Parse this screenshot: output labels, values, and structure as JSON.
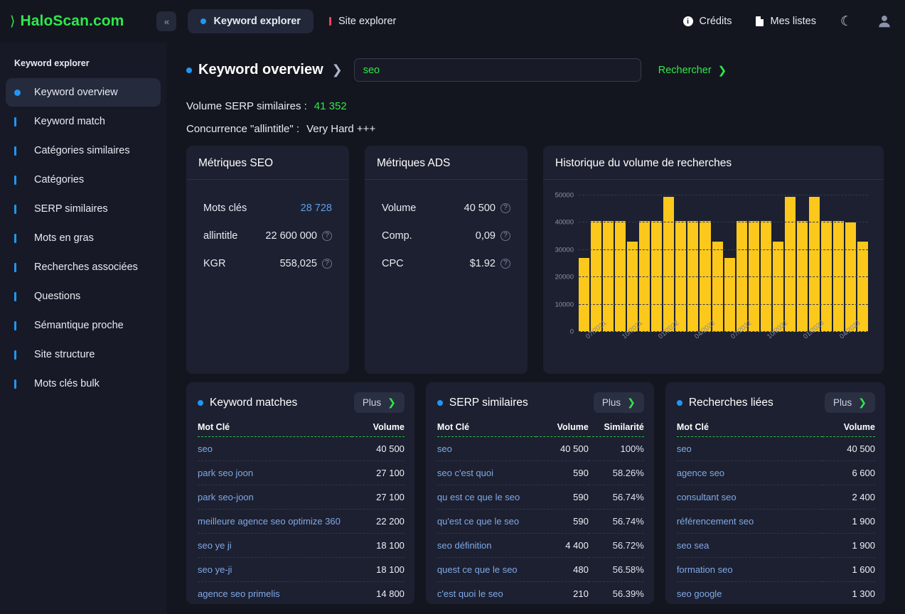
{
  "topbar": {
    "brand": "HaloScan.com",
    "brand_chevron": "⟩",
    "collapse_label": "«",
    "tabs": [
      {
        "label": "Keyword explorer",
        "marker": "dot-blue",
        "active": true
      },
      {
        "label": "Site explorer",
        "marker": "bar-pink",
        "active": false
      }
    ],
    "credits_label": "Crédits",
    "credits_icon": "info-icon",
    "lists_label": "Mes listes",
    "lists_icon": "document-icon",
    "theme_icon": "moon-icon",
    "theme_glyph": "☾",
    "account_icon": "user-avatar-icon"
  },
  "sidebar": {
    "title": "Keyword explorer",
    "items": [
      {
        "label": "Keyword overview",
        "active": true
      },
      {
        "label": "Keyword match",
        "active": false
      },
      {
        "label": "Catégories similaires",
        "active": false
      },
      {
        "label": "Catégories",
        "active": false
      },
      {
        "label": "SERP similaires",
        "active": false
      },
      {
        "label": "Mots en gras",
        "active": false
      },
      {
        "label": "Recherches associées",
        "active": false
      },
      {
        "label": "Questions",
        "active": false
      },
      {
        "label": "Sémantique proche",
        "active": false
      },
      {
        "label": "Site structure",
        "active": false
      },
      {
        "label": "Mots clés bulk",
        "active": false
      }
    ]
  },
  "page": {
    "title": "Keyword overview",
    "title_chevron": "❯",
    "search_value": "seo",
    "search_placeholder": "seo",
    "search_button": "Rechercher",
    "search_button_chevron": "❯",
    "summary": [
      {
        "label": "Volume SERP similaires :",
        "value": "41 352",
        "style": "green"
      },
      {
        "label": "Concurrence \"allintitle\" :",
        "value": "Very Hard +++",
        "style": "plain"
      }
    ]
  },
  "metrics_seo": {
    "title": "Métriques SEO",
    "rows": [
      {
        "label": "Mots clés",
        "value": "28 728",
        "help": false,
        "blue": true
      },
      {
        "label": "allintitle",
        "value": "22 600 000",
        "help": true,
        "blue": false
      },
      {
        "label": "KGR",
        "value": "558,025",
        "help": true,
        "blue": false
      }
    ]
  },
  "metrics_ads": {
    "title": "Métriques ADS",
    "rows": [
      {
        "label": "Volume",
        "value": "40 500",
        "help": true,
        "blue": false
      },
      {
        "label": "Comp.",
        "value": "0,09",
        "help": true,
        "blue": false
      },
      {
        "label": "CPC",
        "value": "$1.92",
        "help": true,
        "blue": false
      }
    ]
  },
  "chart_data": {
    "type": "bar",
    "title": "Historique du volume de recherches",
    "xlabel": "",
    "ylabel": "",
    "ylim": [
      0,
      52000
    ],
    "yticks": [
      0,
      10000,
      20000,
      30000,
      40000,
      50000
    ],
    "ytick_labels": [
      "0",
      "10000",
      "20000",
      "30000",
      "40000",
      "50000"
    ],
    "grid": true,
    "legend": "none",
    "bar_color": "#fcc81b",
    "categories": [
      "07/2021",
      "08/2021",
      "09/2021",
      "10/2021",
      "11/2021",
      "12/2021",
      "01/2022",
      "02/2022",
      "03/2022",
      "04/2022",
      "05/2022",
      "06/2022",
      "07/2022",
      "08/2022",
      "09/2022",
      "10/2022",
      "11/2022",
      "12/2022",
      "01/2023",
      "02/2023",
      "03/2023",
      "04/2023",
      "05/2023",
      "06/2023"
    ],
    "tick_labels_shown": [
      "07/2021",
      "10/2021",
      "01/2022",
      "04/2022",
      "07/2022",
      "10/2022",
      "01/2023",
      "04/2023"
    ],
    "tick_label_indices": [
      0,
      3,
      6,
      9,
      12,
      15,
      18,
      21
    ],
    "values": [
      27100,
      40500,
      40500,
      40500,
      33100,
      40500,
      40500,
      49500,
      40500,
      40500,
      40500,
      33100,
      27100,
      40500,
      40500,
      40500,
      33100,
      49500,
      40500,
      49500,
      40500,
      40500,
      40000,
      33100
    ]
  },
  "keyword_matches": {
    "title": "Keyword matches",
    "more_label": "Plus",
    "more_chevron": "❯",
    "columns": [
      "Mot Clé",
      "Volume"
    ],
    "rows": [
      {
        "keyword": "seo",
        "volume": "40 500"
      },
      {
        "keyword": "park seo joon",
        "volume": "27 100"
      },
      {
        "keyword": "park seo-joon",
        "volume": "27 100"
      },
      {
        "keyword": "meilleure agence seo optimize 360",
        "volume": "22 200"
      },
      {
        "keyword": "seo ye ji",
        "volume": "18 100"
      },
      {
        "keyword": "seo ye-ji",
        "volume": "18 100"
      },
      {
        "keyword": "agence seo primelis",
        "volume": "14 800"
      }
    ]
  },
  "serp_similaires": {
    "title": "SERP similaires",
    "more_label": "Plus",
    "more_chevron": "❯",
    "columns": [
      "Mot Clé",
      "Volume",
      "Similarité"
    ],
    "rows": [
      {
        "keyword": "seo",
        "volume": "40 500",
        "similarity": "100%"
      },
      {
        "keyword": "seo c'est quoi",
        "volume": "590",
        "similarity": "58.26%"
      },
      {
        "keyword": "qu est ce que le seo",
        "volume": "590",
        "similarity": "56.74%"
      },
      {
        "keyword": "qu'est ce que le seo",
        "volume": "590",
        "similarity": "56.74%"
      },
      {
        "keyword": "seo définition",
        "volume": "4 400",
        "similarity": "56.72%"
      },
      {
        "keyword": "quest ce que le seo",
        "volume": "480",
        "similarity": "56.58%"
      },
      {
        "keyword": "c'est quoi le seo",
        "volume": "210",
        "similarity": "56.39%"
      }
    ]
  },
  "recherches_liees": {
    "title": "Recherches liées",
    "more_label": "Plus",
    "more_chevron": "❯",
    "columns": [
      "Mot Clé",
      "Volume"
    ],
    "rows": [
      {
        "keyword": "seo",
        "volume": "40 500"
      },
      {
        "keyword": "agence seo",
        "volume": "6 600"
      },
      {
        "keyword": "consultant seo",
        "volume": "2 400"
      },
      {
        "keyword": "référencement seo",
        "volume": "1 900"
      },
      {
        "keyword": "seo sea",
        "volume": "1 900"
      },
      {
        "keyword": "formation seo",
        "volume": "1 600"
      },
      {
        "keyword": "seo google",
        "volume": "1 300"
      }
    ]
  },
  "colors": {
    "accent_green": "#2ee84a",
    "accent_blue": "#2196f3",
    "accent_pink": "#f2415f",
    "bar_yellow": "#fcc81b",
    "page_bg": "#14161f",
    "card_bg": "#1d2030",
    "sidebar_bg": "#171a26",
    "link_blue": "#7fa9e8"
  }
}
